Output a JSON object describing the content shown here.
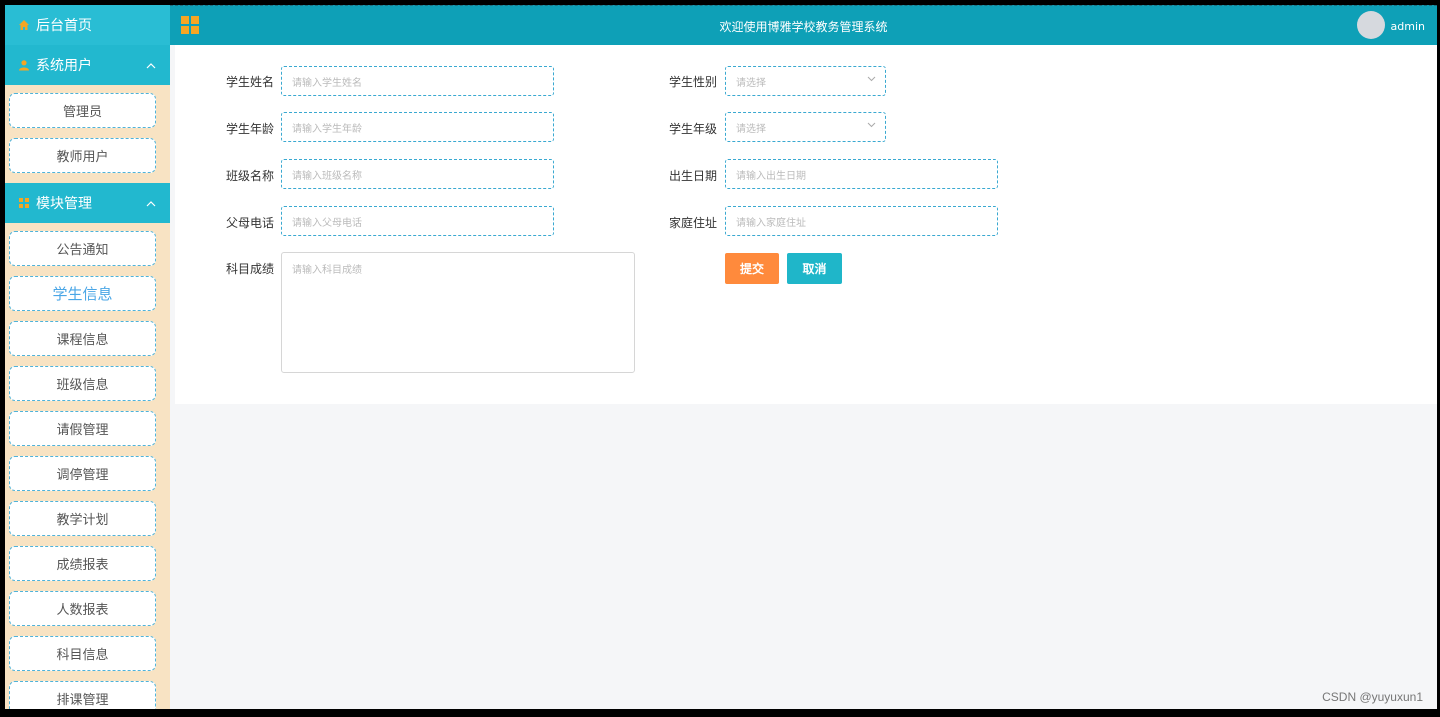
{
  "topbar": {
    "title": "欢迎使用博雅学校教务管理系统",
    "username": "admin"
  },
  "sidebar": {
    "home": "后台首页",
    "groups": [
      {
        "label": "系统用户",
        "items": [
          "管理员",
          "教师用户"
        ]
      },
      {
        "label": "模块管理",
        "items": [
          "公告通知",
          "学生信息",
          "课程信息",
          "班级信息",
          "请假管理",
          "调停管理",
          "教学计划",
          "成绩报表",
          "人数报表",
          "科目信息",
          "排课管理"
        ]
      }
    ],
    "active_item": "学生信息"
  },
  "form": {
    "name": {
      "label": "学生姓名",
      "placeholder": "请输入学生姓名"
    },
    "gender": {
      "label": "学生性别",
      "placeholder": "请选择"
    },
    "age": {
      "label": "学生年龄",
      "placeholder": "请输入学生年龄"
    },
    "grade": {
      "label": "学生年级",
      "placeholder": "请选择"
    },
    "class": {
      "label": "班级名称",
      "placeholder": "请输入班级名称"
    },
    "birthday": {
      "label": "出生日期",
      "placeholder": "请输入出生日期"
    },
    "parent_phone": {
      "label": "父母电话",
      "placeholder": "请输入父母电话"
    },
    "address": {
      "label": "家庭住址",
      "placeholder": "请输入家庭住址"
    },
    "scores": {
      "label": "科目成绩",
      "placeholder": "请输入科目成绩"
    },
    "submit_label": "提交",
    "cancel_label": "取消"
  },
  "watermark": "CSDN @yuyuxun1",
  "colors": {
    "sidebar_bg": "#f8e3c3",
    "menu_head": "#22b8cf",
    "topbar": "#0ea0b7",
    "submit": "#ff8a3c",
    "cancel": "#1fb6c9",
    "active_item": "#4aa6e6"
  }
}
